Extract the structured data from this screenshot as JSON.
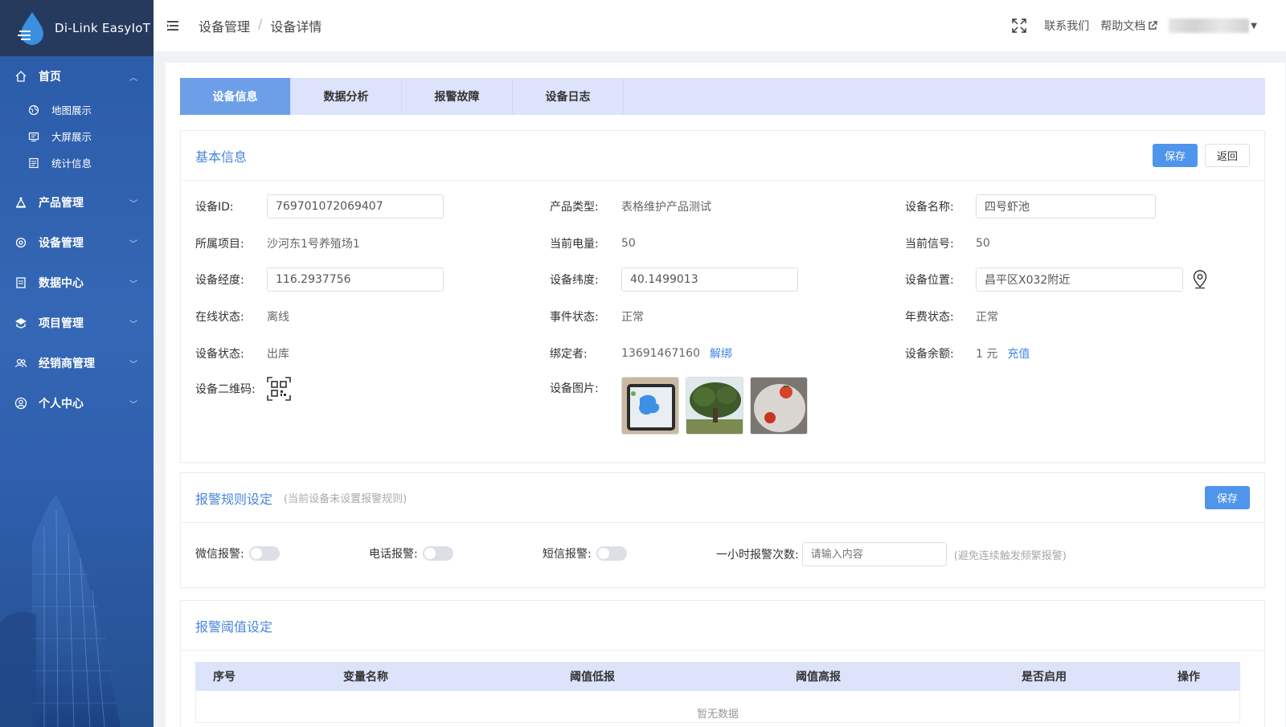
{
  "app": {
    "name": "Di-Link EasyIoT"
  },
  "sidebar": {
    "items": [
      {
        "label": "首页",
        "icon": "home-icon",
        "expanded": true,
        "children": [
          {
            "label": "地图展示",
            "icon": "map-icon"
          },
          {
            "label": "大屏展示",
            "icon": "screen-icon"
          },
          {
            "label": "统计信息",
            "icon": "stats-icon"
          }
        ]
      },
      {
        "label": "产品管理",
        "icon": "product-icon"
      },
      {
        "label": "设备管理",
        "icon": "device-icon"
      },
      {
        "label": "数据中心",
        "icon": "data-icon"
      },
      {
        "label": "项目管理",
        "icon": "project-icon"
      },
      {
        "label": "经销商管理",
        "icon": "dealer-icon"
      },
      {
        "label": "个人中心",
        "icon": "user-icon"
      }
    ]
  },
  "header": {
    "breadcrumb": [
      "设备管理",
      "设备详情"
    ],
    "contact": "联系我们",
    "help": "帮助文档"
  },
  "tabs": [
    {
      "label": "设备信息",
      "active": true
    },
    {
      "label": "数据分析",
      "active": false
    },
    {
      "label": "报警故障",
      "active": false
    },
    {
      "label": "设备日志",
      "active": false
    }
  ],
  "basic": {
    "title": "基本信息",
    "save": "保存",
    "back": "返回",
    "device_id": {
      "label": "设备ID:",
      "value": "769701072069407"
    },
    "product_type": {
      "label": "产品类型:",
      "value": "表格维护产品测试"
    },
    "device_name": {
      "label": "设备名称:",
      "value": "四号虾池"
    },
    "project": {
      "label": "所属项目:",
      "value": "沙河东1号养殖场1"
    },
    "battery": {
      "label": "当前电量:",
      "value": "50"
    },
    "signal": {
      "label": "当前信号:",
      "value": "50"
    },
    "longitude": {
      "label": "设备经度:",
      "value": "116.2937756"
    },
    "latitude": {
      "label": "设备纬度:",
      "value": "40.1499013"
    },
    "location": {
      "label": "设备位置:",
      "value": "昌平区X032附近"
    },
    "online": {
      "label": "在线状态:",
      "value": "离线"
    },
    "event": {
      "label": "事件状态:",
      "value": "正常"
    },
    "fee": {
      "label": "年费状态:",
      "value": "正常"
    },
    "status": {
      "label": "设备状态:",
      "value": "出库"
    },
    "binder": {
      "label": "绑定者:",
      "value": "13691467160",
      "action": "解绑"
    },
    "balance": {
      "label": "设备余额:",
      "value": "1 元",
      "action": "充值"
    },
    "qrcode": {
      "label": "设备二维码:"
    },
    "images": {
      "label": "设备图片:"
    }
  },
  "alarm_rules": {
    "title": "报警规则设定",
    "note": "(当前设备未设置报警规则)",
    "save": "保存",
    "wechat": "微信报警:",
    "phone": "电话报警:",
    "sms": "短信报警:",
    "hourly": "一小时报警次数:",
    "hourly_placeholder": "请输入内容",
    "hint": "(避免连续触发频繁报警)"
  },
  "threshold": {
    "title": "报警阈值设定",
    "columns": [
      "序号",
      "变量名称",
      "阈值低报",
      "阈值高报",
      "是否启用",
      "操作"
    ],
    "empty": "暂无数据"
  }
}
